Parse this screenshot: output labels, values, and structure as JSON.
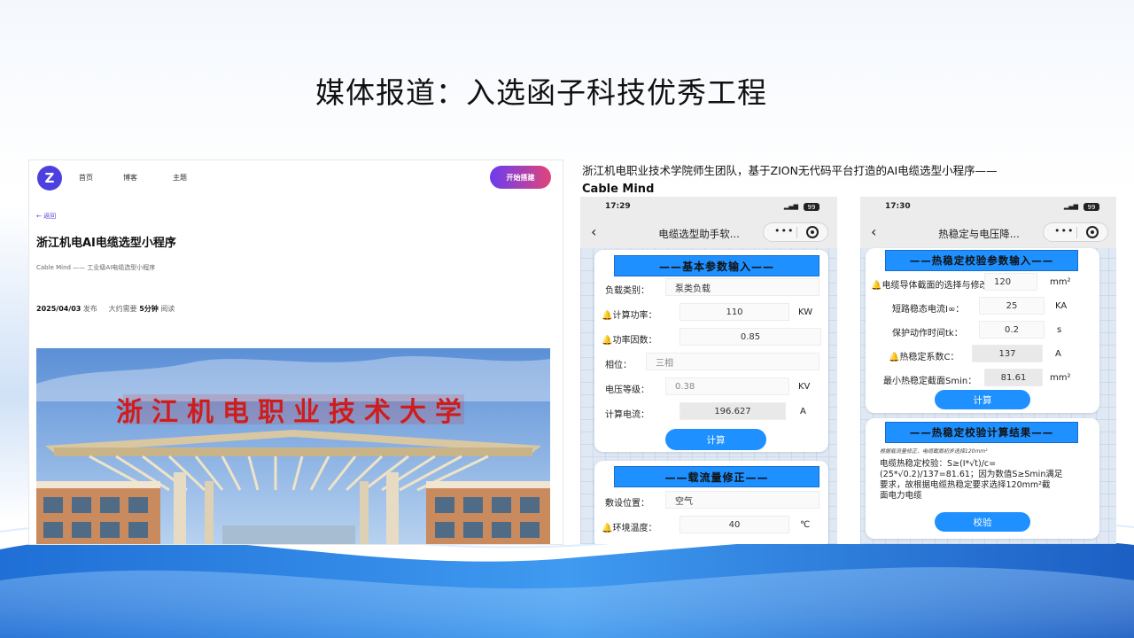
{
  "slide": {
    "title": "媒体报道：入选函子科技优秀工程"
  },
  "website": {
    "logo_text": "Z",
    "nav": [
      "首页",
      "博客",
      "主题"
    ],
    "start_button": "开始搭建",
    "back_link": "← 返回",
    "article_title": "浙江机电AI电缆选型小程序",
    "article_subtitle": "Cable Mind —— 工业级AI电缆选型小程序",
    "publish_date": "2025/04/03",
    "publish_suffix": "发布",
    "read_prefix": "大约需要",
    "read_time": "5分钟",
    "read_suffix": "阅读",
    "gate_sign": "浙江机电职业技术大学"
  },
  "caption": {
    "line1": "浙江机电职业技术学院师生团队，基于ZION无代码平台打造的AI电缆选型小程序——",
    "line2": "Cable Mind"
  },
  "phone1": {
    "time": "17:29",
    "battery": "99",
    "title": "电缆选型助手软...",
    "more": "•••",
    "section1": "——基本参数输入——",
    "rows": [
      {
        "label": "负载类别：",
        "value": "泵类负载",
        "unit": ""
      },
      {
        "label": "计算功率：",
        "value": "110",
        "unit": "KW"
      },
      {
        "label": "功率因数：",
        "value": "0.85",
        "unit": ""
      },
      {
        "label": "相位：",
        "value": "三相",
        "unit": ""
      },
      {
        "label": "电压等级：",
        "value": "0.38",
        "unit": "KV"
      },
      {
        "label": "计算电流：",
        "value": "196.627",
        "unit": "A"
      }
    ],
    "calc_button": "计算",
    "section2": "——载流量修正——",
    "rows2": [
      {
        "label": "敷设位置：",
        "value": "空气",
        "unit": ""
      },
      {
        "label": "环境温度：",
        "value": "40",
        "unit": "℃"
      }
    ]
  },
  "phone2": {
    "time": "17:30",
    "battery": "99",
    "title": "热稳定与电压降...",
    "more": "•••",
    "section1": "——热稳定校验参数输入——",
    "rows": [
      {
        "label": "电缆导体截面的选择与修改：",
        "value": "120",
        "unit": "mm²"
      },
      {
        "label": "短路稳态电流I∞：",
        "value": "25",
        "unit": "KA"
      },
      {
        "label": "保护动作时间tk：",
        "value": "0.2",
        "unit": "s"
      },
      {
        "label": "热稳定系数C：",
        "value": "137",
        "unit": "A"
      },
      {
        "label": "最小热稳定截面Smin：",
        "value": "81.61",
        "unit": "mm²"
      }
    ],
    "calc_button": "计算",
    "section2": "——热稳定校验计算结果——",
    "note": "根据载流量修正，电缆截面初步选择120mm²",
    "result_lines": [
      "电缆热稳定校验：S≥(I*√t)/c=",
      "(25*√0.2)/137=81.61；因为数值S≥Smin满足",
      "要求，故根据电缆热稳定要求选择120mm²截",
      "面电力电缆"
    ],
    "verify_button": "校验"
  }
}
